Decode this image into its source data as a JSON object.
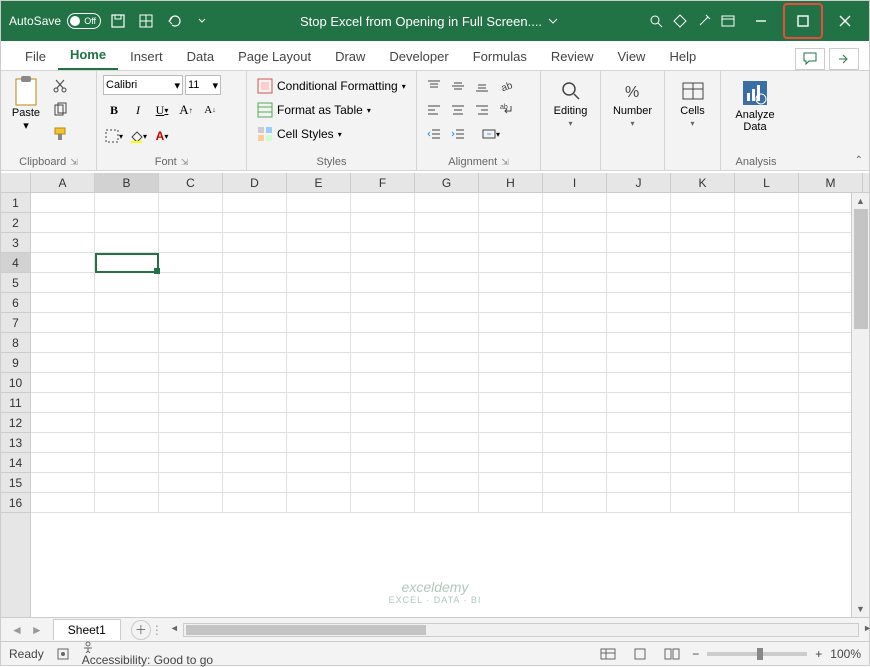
{
  "titlebar": {
    "autosave_label": "AutoSave",
    "autosave_state": "Off",
    "filename": "Stop Excel from Opening in Full Screen...."
  },
  "tabs": [
    "File",
    "Home",
    "Insert",
    "Data",
    "Page Layout",
    "Draw",
    "Developer",
    "Formulas",
    "Review",
    "View",
    "Help"
  ],
  "active_tab": "Home",
  "ribbon": {
    "clipboard": {
      "paste": "Paste",
      "label": "Clipboard"
    },
    "font": {
      "name": "Calibri",
      "size": "11",
      "label": "Font"
    },
    "styles": {
      "conditional": "Conditional Formatting",
      "table": "Format as Table",
      "cell": "Cell Styles",
      "label": "Styles"
    },
    "alignment": {
      "label": "Alignment"
    },
    "editing": {
      "label": "Editing"
    },
    "number": {
      "label": "Number"
    },
    "cells": {
      "label": "Cells"
    },
    "analysis": {
      "btn": "Analyze Data",
      "label": "Analysis"
    }
  },
  "columns": [
    "A",
    "B",
    "C",
    "D",
    "E",
    "F",
    "G",
    "H",
    "I",
    "J",
    "K",
    "L",
    "M"
  ],
  "rows": [
    "1",
    "2",
    "3",
    "4",
    "5",
    "6",
    "7",
    "8",
    "9",
    "10",
    "11",
    "12",
    "13",
    "14",
    "15",
    "16"
  ],
  "selected_cell": "B4",
  "sheet": {
    "name": "Sheet1"
  },
  "status": {
    "ready": "Ready",
    "accessibility": "Accessibility: Good to go",
    "zoom": "100%"
  },
  "watermark": {
    "brand": "exceldemy",
    "tagline": "EXCEL · DATA · BI"
  }
}
